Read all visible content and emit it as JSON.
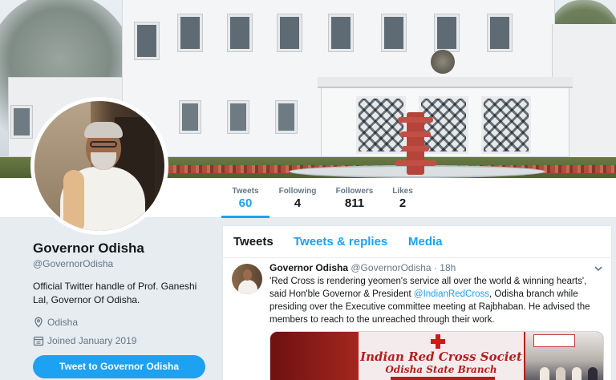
{
  "profile": {
    "display_name": "Governor Odisha",
    "handle": "@GovernorOdisha",
    "bio": "Official Twitter handle of Prof. Ganeshi Lal, Governor Of Odisha.",
    "location": "Odisha",
    "joined": "Joined January 2019",
    "tweet_to_button": "Tweet to Governor Odisha"
  },
  "stats": [
    {
      "label": "Tweets",
      "value": "60"
    },
    {
      "label": "Following",
      "value": "4"
    },
    {
      "label": "Followers",
      "value": "811"
    },
    {
      "label": "Likes",
      "value": "2"
    }
  ],
  "tabs": [
    {
      "label": "Tweets"
    },
    {
      "label": "Tweets & replies"
    },
    {
      "label": "Media"
    }
  ],
  "tweet": {
    "name": "Governor Odisha",
    "handle": "@GovernorOdisha",
    "separator": "·",
    "time": "18h",
    "text_part1": "'Red Cross is rendering yeomen's service all over the world & winning hearts', said Hon'ble Governor & President ",
    "mention": "@IndianRedCross",
    "text_part2": ", Odisha branch while presiding over the Executive committee meeting at Rajbhaban. He advised the members  to reach to the unreached through their work.",
    "media": {
      "banner_title": "Indian Red Cross Societ",
      "banner_subtitle": "Odisha State Branch"
    }
  },
  "colors": {
    "accent": "#1da1f2",
    "background": "#e6ecf0",
    "text_primary": "#14171a",
    "text_secondary": "#657786"
  },
  "icons": {
    "location": "map-pin-icon",
    "joined": "calendar-icon",
    "tweet_menu": "chevron-down-icon"
  }
}
